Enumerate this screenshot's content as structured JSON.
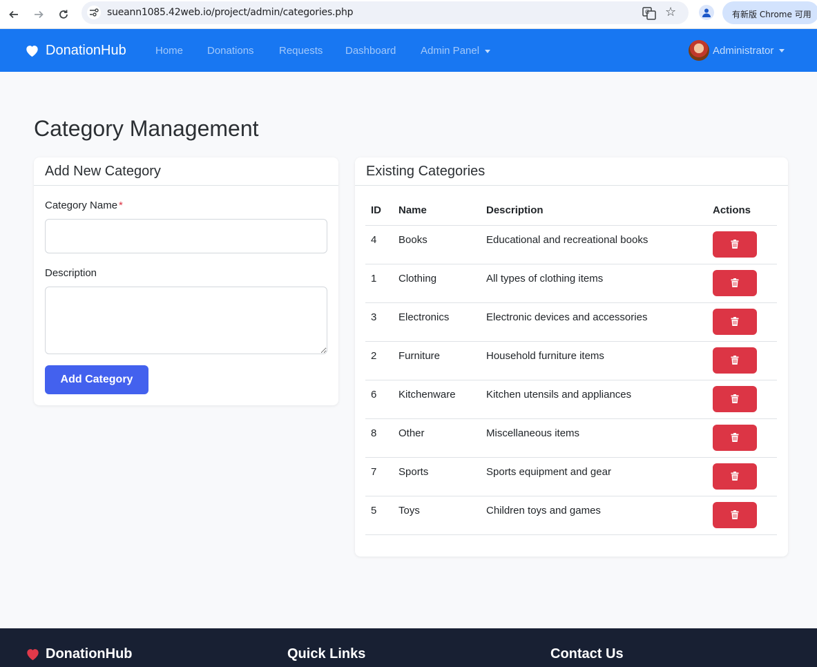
{
  "browser": {
    "url": "sueann1085.42web.io/project/admin/categories.php",
    "update_label": "有新版 Chrome 可用"
  },
  "navbar": {
    "brand": "DonationHub",
    "links": [
      "Home",
      "Donations",
      "Requests",
      "Dashboard",
      "Admin Panel"
    ],
    "user": "Administrator"
  },
  "page": {
    "title": "Category Management"
  },
  "add_form": {
    "header": "Add New Category",
    "name_label": "Category Name",
    "required_mark": "*",
    "name_value": "",
    "description_label": "Description",
    "description_value": "",
    "submit_label": "Add Category"
  },
  "categories": {
    "header": "Existing Categories",
    "columns": [
      "ID",
      "Name",
      "Description",
      "Actions"
    ],
    "rows": [
      {
        "id": "4",
        "name": "Books",
        "description": "Educational and recreational books"
      },
      {
        "id": "1",
        "name": "Clothing",
        "description": "All types of clothing items"
      },
      {
        "id": "3",
        "name": "Electronics",
        "description": "Electronic devices and accessories"
      },
      {
        "id": "2",
        "name": "Furniture",
        "description": "Household furniture items"
      },
      {
        "id": "6",
        "name": "Kitchenware",
        "description": "Kitchen utensils and appliances"
      },
      {
        "id": "8",
        "name": "Other",
        "description": "Miscellaneous items"
      },
      {
        "id": "7",
        "name": "Sports",
        "description": "Sports equipment and gear"
      },
      {
        "id": "5",
        "name": "Toys",
        "description": "Children toys and games"
      }
    ],
    "delete_icon": "trash-icon"
  },
  "footer": {
    "brand": "DonationHub",
    "quick_links_heading": "Quick Links",
    "contact_heading": "Contact Us"
  },
  "colors": {
    "navbar": "#1877f2",
    "primary_button": "#4361ee",
    "danger": "#dc3545",
    "footer": "#182033",
    "heart_footer": "#e0394a"
  }
}
